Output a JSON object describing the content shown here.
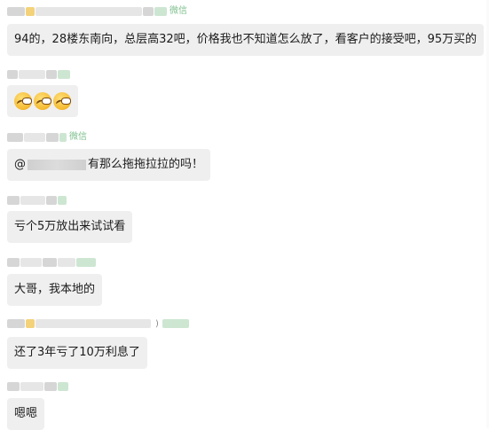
{
  "source_label": "微信",
  "messages": [
    {
      "type": "text",
      "text": "94的，28楼东南向，总层高32吧，价格我也不知道怎么放了，看客户的接受吧，95万买的"
    },
    {
      "type": "emoji",
      "emojis": [
        "facepalm-emoji",
        "facepalm-emoji",
        "facepalm-emoji"
      ]
    },
    {
      "type": "mention",
      "prefix": "@",
      "text": "有那么拖拖拉拉的吗！"
    },
    {
      "type": "text",
      "text": "亏个5万放出来试试看"
    },
    {
      "type": "text",
      "text": "大哥，我本地的"
    },
    {
      "type": "text",
      "text": "还了3年亏了10万利息了"
    },
    {
      "type": "text",
      "text": "嗯嗯"
    }
  ],
  "sender_suffix": ")"
}
